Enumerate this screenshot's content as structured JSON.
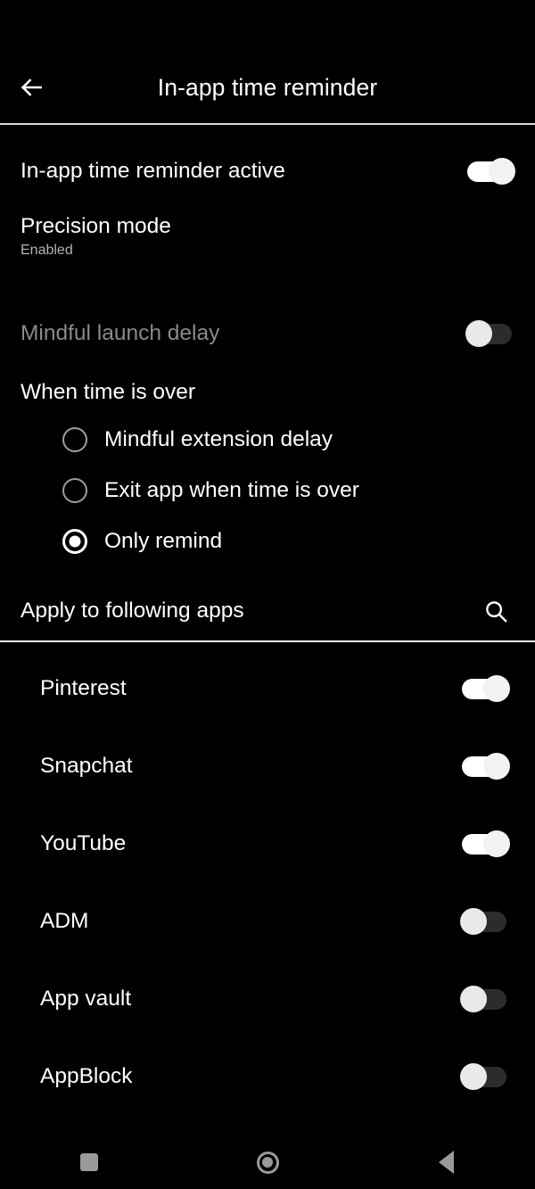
{
  "appbar": {
    "back_icon": "arrow-left-icon",
    "title": "In-app time reminder"
  },
  "settings": {
    "reminder_active": {
      "label": "In-app time reminder active",
      "toggle_state": "on"
    },
    "precision_mode": {
      "label": "Precision mode",
      "value": "Enabled"
    },
    "mindful_launch_delay": {
      "label": "Mindful launch delay",
      "toggle_state": "off",
      "disabled": true
    }
  },
  "when_time_over": {
    "title": "When time is over",
    "options": [
      {
        "label": "Mindful extension delay",
        "selected": false
      },
      {
        "label": "Exit app when time is over",
        "selected": false
      },
      {
        "label": "Only remind",
        "selected": true
      }
    ]
  },
  "apply_section": {
    "label": "Apply to following apps",
    "search_icon": "search-icon"
  },
  "apps": [
    {
      "name": "Pinterest",
      "toggle_state": "on"
    },
    {
      "name": "Snapchat",
      "toggle_state": "on"
    },
    {
      "name": "YouTube",
      "toggle_state": "on"
    },
    {
      "name": "ADM",
      "toggle_state": "off"
    },
    {
      "name": "App vault",
      "toggle_state": "off"
    },
    {
      "name": "AppBlock",
      "toggle_state": "off"
    }
  ],
  "navbar": {
    "recents_icon": "square-recents-icon",
    "home_icon": "circle-home-icon",
    "back_icon": "triangle-back-icon"
  },
  "colors": {
    "background": "#000000",
    "text_primary": "#ffffff",
    "text_secondary": "#b4b4b4",
    "text_disabled": "#8a8a8a",
    "divider": "#d8d8d8",
    "toggle_on_track": "#ffffff",
    "toggle_off_track": "#2c2c2c",
    "nav_icon": "#9a9a9a"
  }
}
